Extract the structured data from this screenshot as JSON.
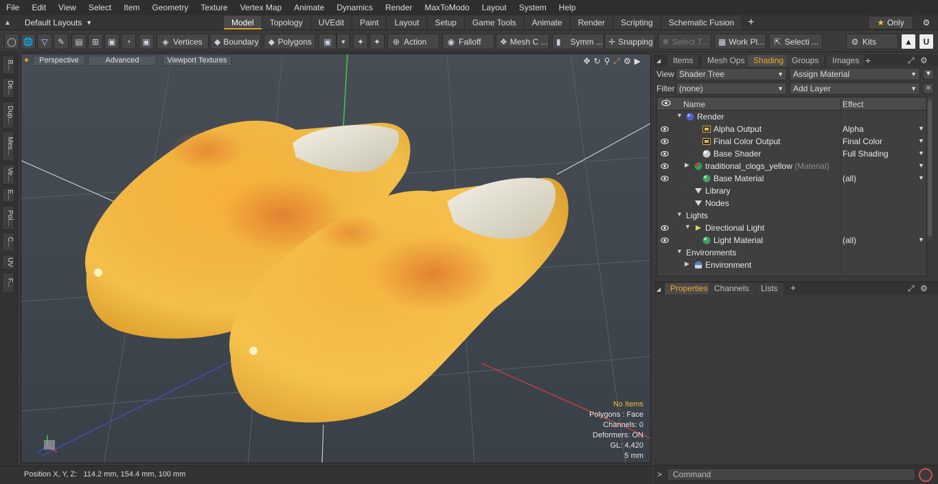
{
  "menu": [
    "File",
    "Edit",
    "View",
    "Select",
    "Item",
    "Geometry",
    "Texture",
    "Vertex Map",
    "Animate",
    "Dynamics",
    "Render",
    "MaxToModo",
    "Layout",
    "System",
    "Help"
  ],
  "layout": {
    "selector": "Default Layouts",
    "tabs": [
      "Model",
      "Topology",
      "UVEdit",
      "Paint",
      "Layout",
      "Setup",
      "Game Tools",
      "Animate",
      "Render",
      "Scripting",
      "Schematic Fusion"
    ],
    "active_tab": "Model",
    "only_label": "Only"
  },
  "toolbar": {
    "vertices": "Vertices",
    "boundary": "Boundary",
    "polygons": "Polygons",
    "action": "Action",
    "falloff": "Falloff",
    "mesh": "Mesh C ...",
    "symm": "Symm ...",
    "snapping": "Snapping",
    "select_t": "Select T...",
    "work_pl": "Work Pl...",
    "selecti": "Selecti ...",
    "kits": "Kits"
  },
  "left_strip": [
    "B...",
    "De...",
    "Dup...",
    "Mes...",
    "Ve...",
    "E...",
    "Pol...",
    "C...",
    "UV",
    "F..."
  ],
  "viewport": {
    "perspective": "Perspective",
    "advanced": "Advanced",
    "textures": "Viewport Textures",
    "info": {
      "items": "No Items",
      "polygons": "Polygons : Face",
      "channels": "Channels: 0",
      "deformers": "Deformers: ON",
      "gl": "GL: 4,420",
      "scale": "5 mm"
    }
  },
  "status": {
    "position": "Position X, Y, Z:   114.2 mm, 154.4 mm, 100 mm"
  },
  "right_panel": {
    "tabs": [
      "Items",
      "Mesh Ops",
      "Shading",
      "Groups",
      "Images"
    ],
    "active_tab": "Shading",
    "view_label": "View",
    "view_value": "Shader Tree",
    "assign_material": "Assign Material",
    "filter_label": "Filter",
    "filter_value": "(none)",
    "add_layer": "Add Layer",
    "col_name": "Name",
    "col_effect": "Effect",
    "tree": [
      {
        "name": "Render",
        "sub": "",
        "effect": "",
        "depth": 0,
        "eye": false,
        "twist": "open",
        "icon": "sphere-blue-icon"
      },
      {
        "name": "Alpha Output",
        "sub": "",
        "effect": "Alpha",
        "depth": 2,
        "eye": true,
        "twist": "",
        "icon": "output-icon"
      },
      {
        "name": "Final Color Output",
        "sub": "",
        "effect": "Final Color",
        "depth": 2,
        "eye": true,
        "twist": "",
        "icon": "output-icon"
      },
      {
        "name": "Base Shader",
        "sub": "",
        "effect": "Full Shading",
        "depth": 2,
        "eye": true,
        "twist": "",
        "icon": "sphere-white-icon"
      },
      {
        "name": "traditional_clogs_yellow",
        "sub": "(Material)",
        "effect": "",
        "depth": 1,
        "eye": true,
        "twist": "closed",
        "icon": "material-red-icon"
      },
      {
        "name": "Base Material",
        "sub": "",
        "effect": "(all)",
        "depth": 2,
        "eye": true,
        "twist": "",
        "icon": "sphere-green-icon"
      },
      {
        "name": "Library",
        "sub": "",
        "effect": "",
        "depth": 1,
        "eye": false,
        "twist": "",
        "icon": "folder-icon"
      },
      {
        "name": "Nodes",
        "sub": "",
        "effect": "",
        "depth": 1,
        "eye": false,
        "twist": "",
        "icon": "folder-icon"
      },
      {
        "name": "Lights",
        "sub": "",
        "effect": "",
        "depth": 0,
        "eye": false,
        "twist": "open",
        "icon": ""
      },
      {
        "name": "Directional Light",
        "sub": "",
        "effect": "",
        "depth": 1,
        "eye": true,
        "twist": "open",
        "icon": "light-icon"
      },
      {
        "name": "Light Material",
        "sub": "",
        "effect": "(all)",
        "depth": 2,
        "eye": true,
        "twist": "",
        "icon": "sphere-green-icon"
      },
      {
        "name": "Environments",
        "sub": "",
        "effect": "",
        "depth": 0,
        "eye": false,
        "twist": "open",
        "icon": ""
      },
      {
        "name": "Environment",
        "sub": "",
        "effect": "",
        "depth": 1,
        "eye": false,
        "twist": "closed",
        "icon": "environment-icon"
      }
    ],
    "props_tabs": [
      "Properties",
      "Channels",
      "Lists"
    ],
    "props_active": "Properties",
    "command_placeholder": "Command"
  }
}
